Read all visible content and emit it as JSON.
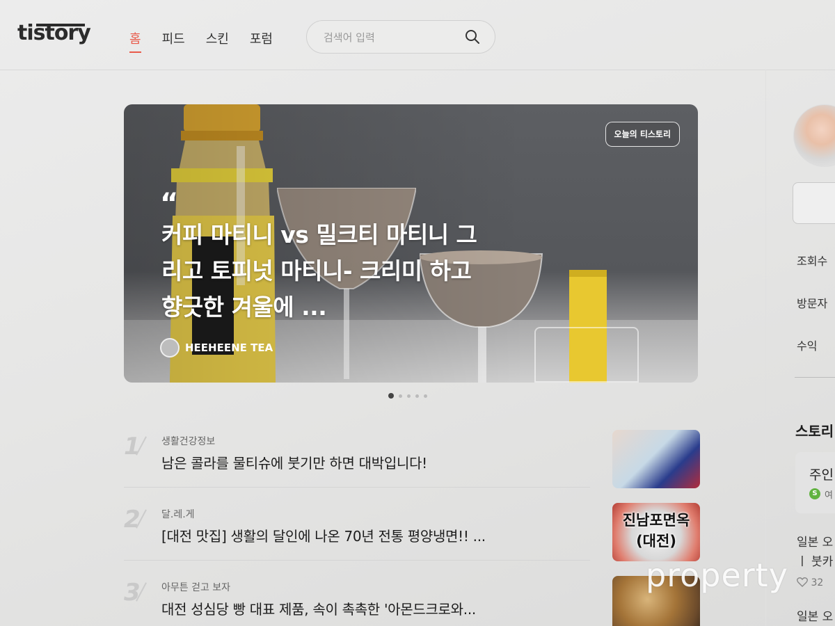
{
  "header": {
    "logo": "tistory",
    "nav": [
      "홈",
      "피드",
      "스킨",
      "포럼"
    ],
    "search_placeholder": "검색어 입력"
  },
  "hero": {
    "badge": "오늘의 티스토리",
    "quote_mark": "“",
    "title": "커피 마티니 vs 밀크티 마티니 그리고 토피넛 마티니- 크리미 하고 향긋한 겨울에 ...",
    "author": "HEEHEENE TEA",
    "slide_count": 5,
    "active_slide": 1
  },
  "posts": [
    {
      "rank": "1",
      "category": "생활건강정보",
      "title": "남은 콜라를 물티슈에 붓기만 하면 대박입니다!"
    },
    {
      "rank": "2",
      "category": "달.레.게",
      "title": "[대전 맛집] 생활의 달인에 나온 70년 전통 평양냉면!! ...",
      "thumb_text": "진남포면옥\n(대전)"
    },
    {
      "rank": "3",
      "category": "아무튼 걷고 보자",
      "title": "대전 성심당 빵 대표 제품, 속이 촉촉한 '아몬드크로와..."
    }
  ],
  "sidebar": {
    "stats": [
      "조회수",
      "방문자",
      "수익"
    ],
    "heading": "스토리",
    "card_title": "주인",
    "card_badge": "S",
    "card_sub": "여",
    "text1": "일본 오",
    "text2": "ㅣ 붓카",
    "likes": "32",
    "text3": "일본 오"
  },
  "watermark": "property",
  "colors": {
    "accent": "#e95a4a"
  }
}
